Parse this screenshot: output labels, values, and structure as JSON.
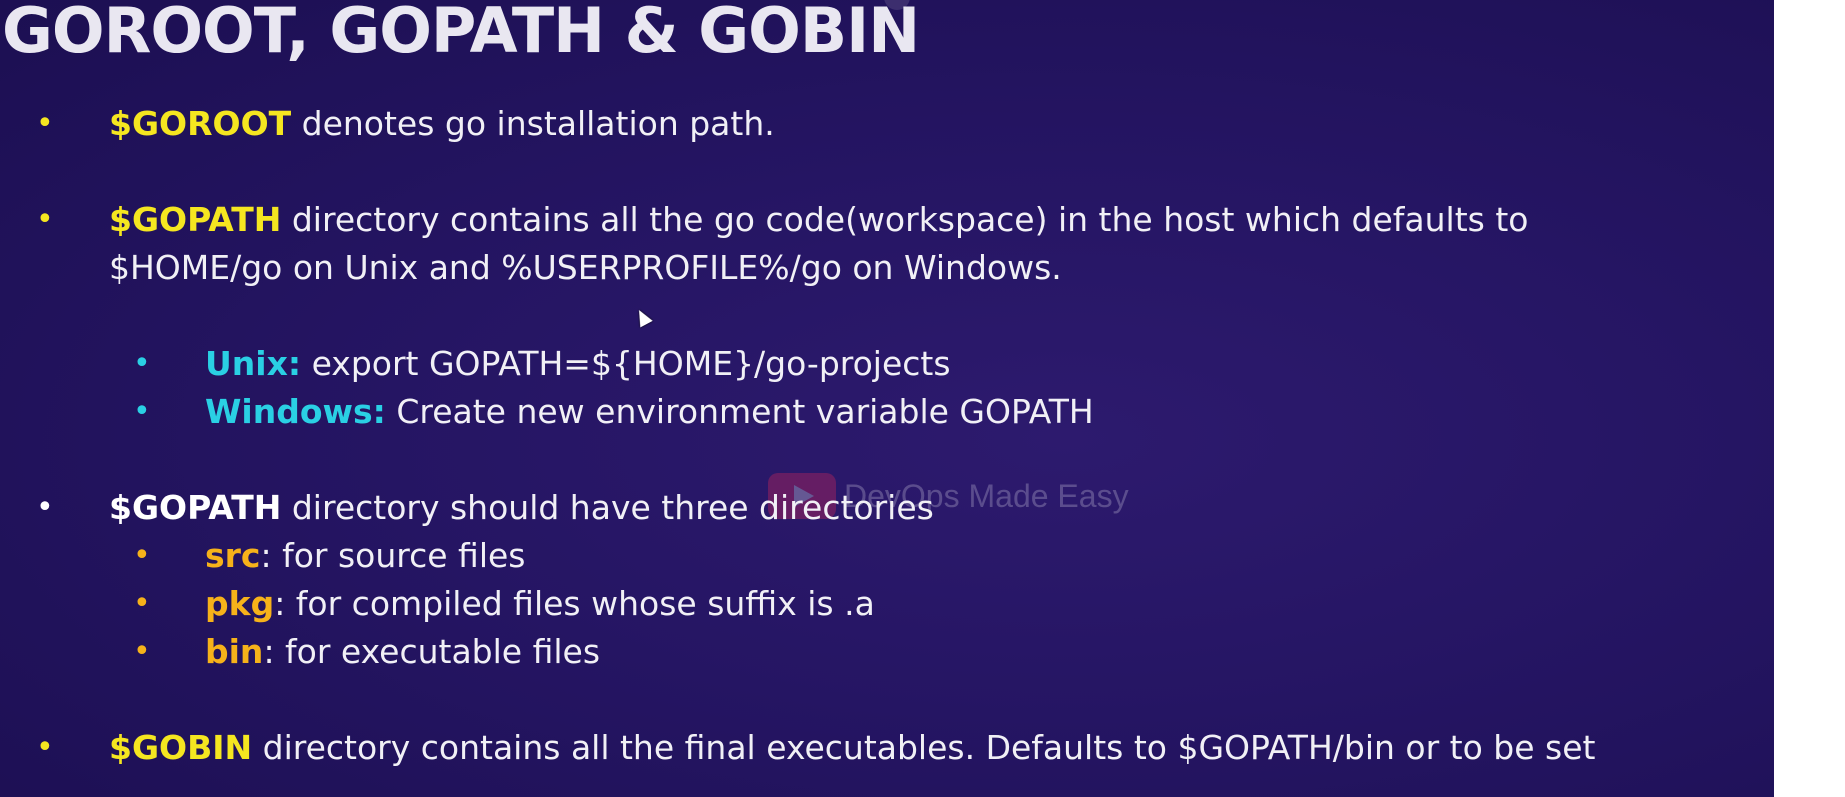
{
  "slide": {
    "title": "GOROOT, GOPATH & GOBIN",
    "watermark": "DevOps Made Easy",
    "colors": {
      "background": "#251563",
      "keyword_yellow": "#f5e620",
      "keyword_cyan": "#2ad0e4",
      "keyword_orange": "#f6b21a",
      "text": "#f1f0f6"
    },
    "bullet_glyph": "•",
    "items": [
      {
        "keyword": "$GOROOT",
        "text": " denotes go installation path."
      },
      {
        "keyword": "$GOPATH",
        "text": " directory contains all the go code(workspace) in the host which defaults to",
        "continuation": "$HOME/go on Unix and %USERPROFILE%/go on Windows."
      },
      {
        "keyword": "Unix:",
        "text": " export GOPATH=${HOME}/go-projects"
      },
      {
        "keyword": "Windows:",
        "text": " Create new environment variable GOPATH"
      },
      {
        "keyword": "$GOPATH",
        "text": " directory should have three directories"
      },
      {
        "keyword": "src",
        "text": ": for source files"
      },
      {
        "keyword": "pkg",
        "text": ": for compiled files whose suffix is .a"
      },
      {
        "keyword": "bin",
        "text": ": for executable files"
      },
      {
        "keyword": "$GOBIN",
        "text": " directory contains all the final executables. Defaults to $GOPATH/bin or to be set"
      }
    ]
  }
}
